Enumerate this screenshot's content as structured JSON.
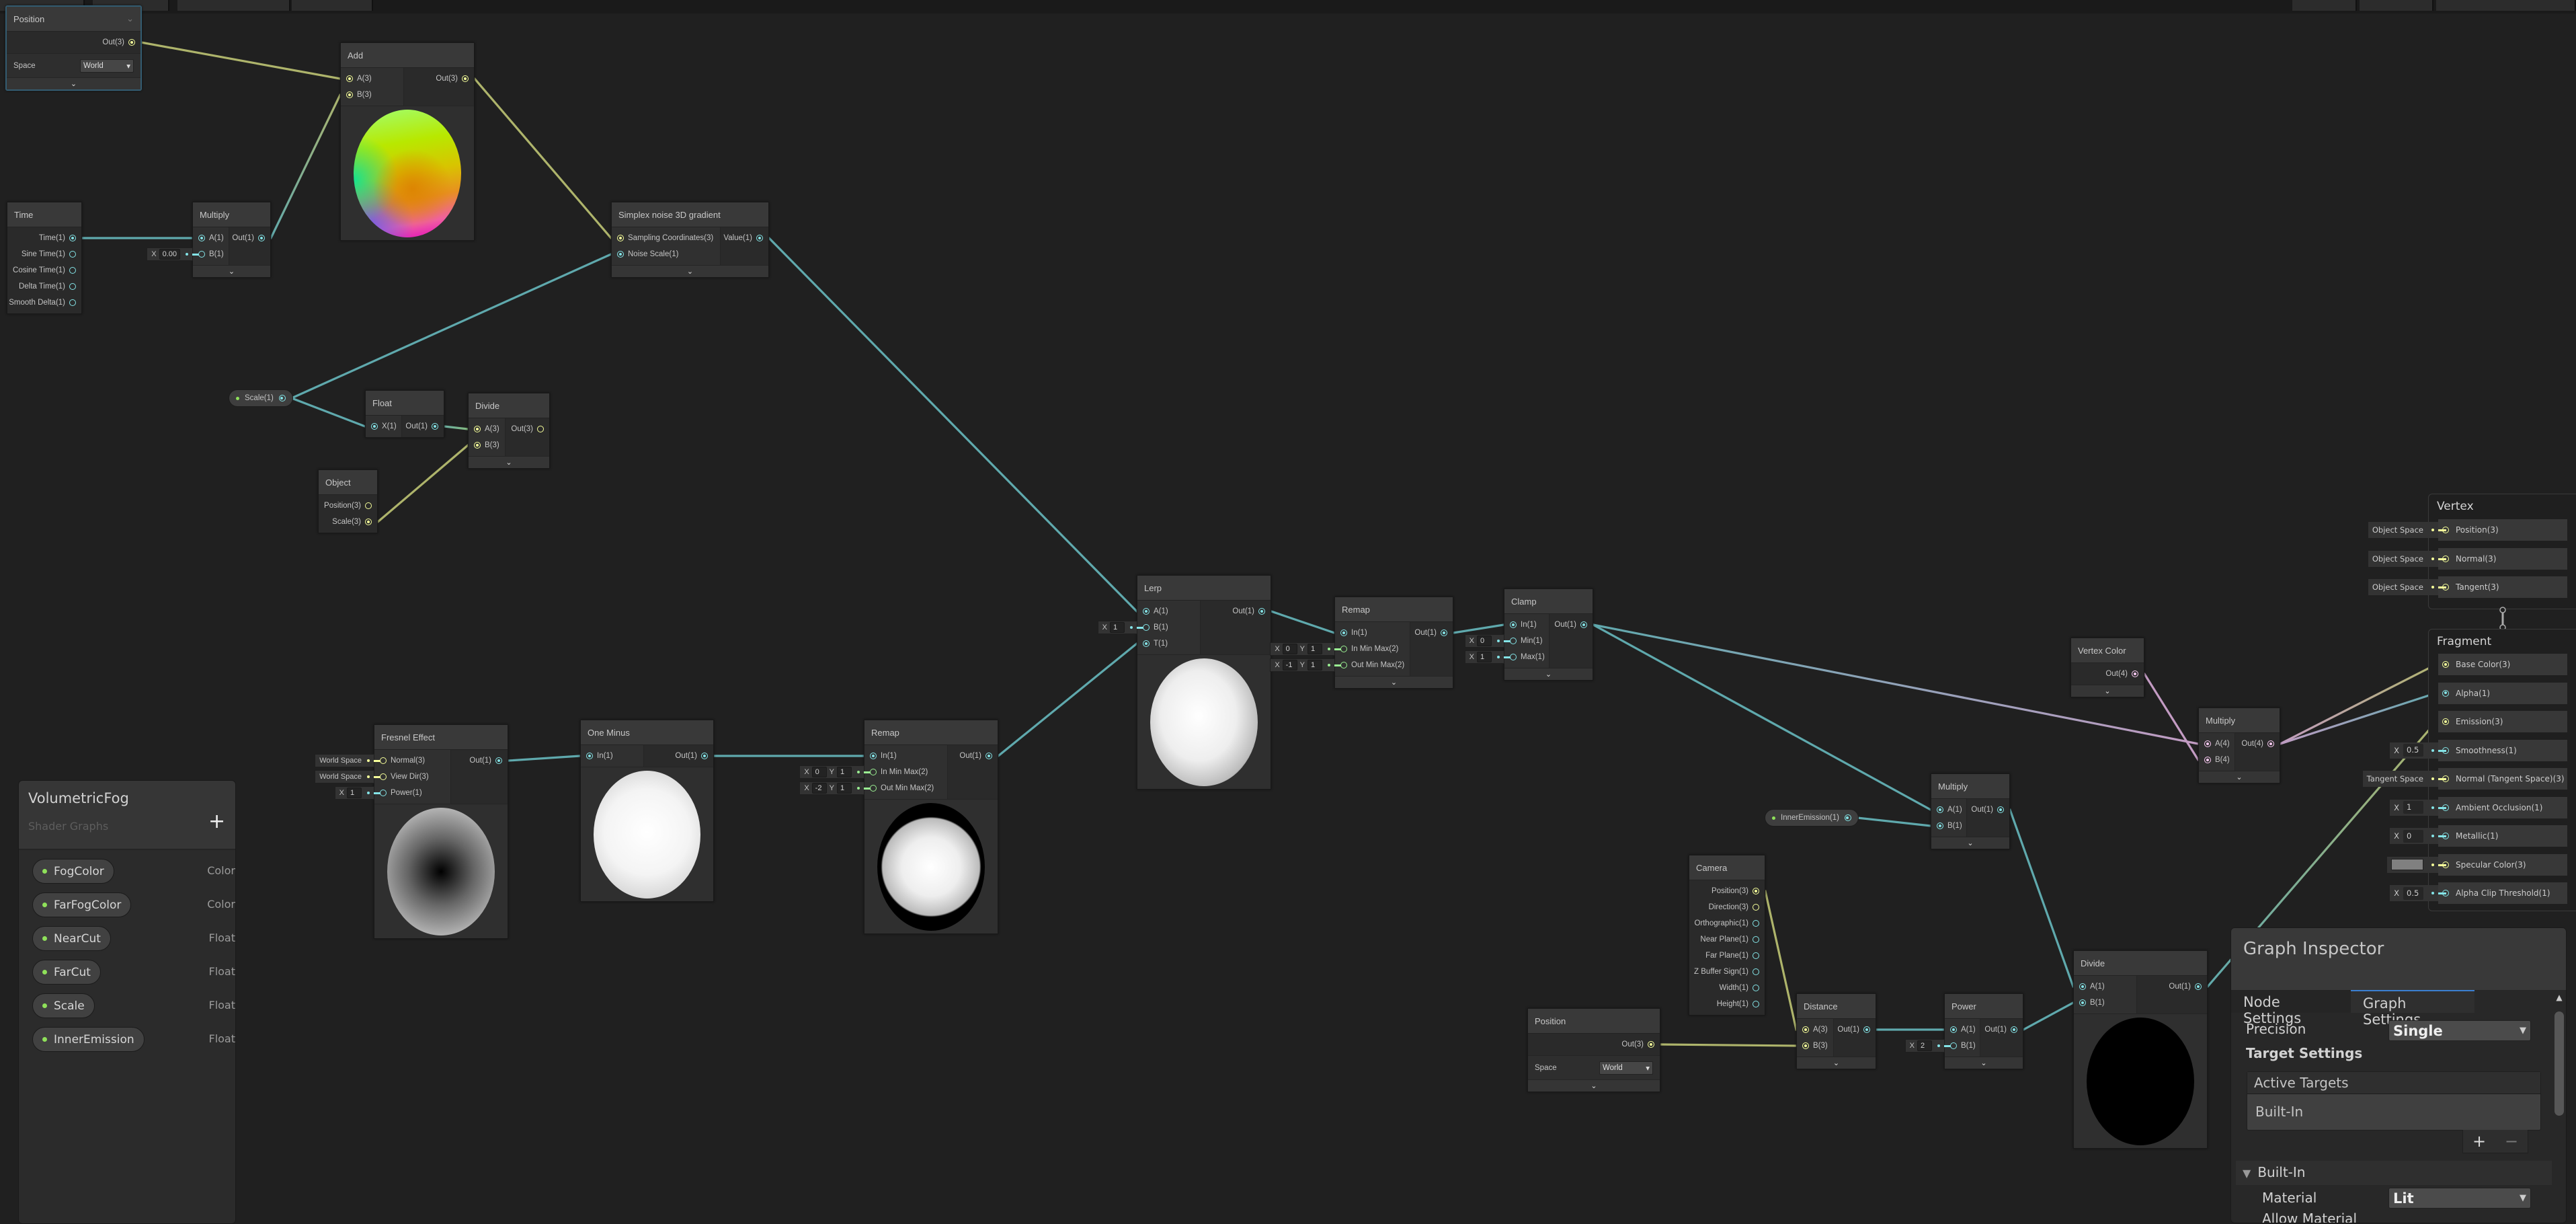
{
  "colors": {
    "port1": "#84e4e7",
    "port2": "#9aef92",
    "port3": "#f6ff9a",
    "port4": "#fbcbf4",
    "edge1": "#5fa9ad",
    "edge2": "#8fbf74",
    "edge3": "#aeb46b",
    "edge4": "#c39bc3",
    "accent": "#3b7fd0",
    "canvas": "#202020"
  },
  "nodes": [
    {
      "title": "Position",
      "collapse_icon": "chevron-down-icon",
      "inputs": [],
      "outputs": [
        "Out(3)"
      ],
      "fields": [
        {
          "label": "Space",
          "value": "World"
        }
      ]
    },
    {
      "title": "Add",
      "inputs": [
        {
          "label": "A(3)"
        },
        {
          "label": "B(3)"
        }
      ],
      "outputs": [
        "Out(3)"
      ],
      "preview": "color-sphere"
    },
    {
      "title": "Time",
      "inputs": [],
      "outputs": [
        "Time(1)",
        "Sine Time(1)",
        "Cosine Time(1)",
        "Delta Time(1)",
        "Smooth Delta(1)"
      ]
    },
    {
      "title": "Multiply",
      "inputs": [
        {
          "label": "A(1)"
        },
        {
          "label": "B(1)",
          "inline": [
            "X",
            "0.00"
          ]
        }
      ],
      "outputs": [
        "Out(1)"
      ]
    },
    {
      "title": "Simplex noise 3D gradient",
      "inputs": [
        {
          "label": "Sampling Coordinates(3)"
        },
        {
          "label": "Noise Scale(1)"
        }
      ],
      "outputs": [
        "Value(1)"
      ]
    },
    {
      "title": "Float",
      "inputs": [
        {
          "label": "X(1)"
        }
      ],
      "outputs": [
        "Out(1)"
      ]
    },
    {
      "title": "Divide",
      "inputs": [
        {
          "label": "A(3)"
        },
        {
          "label": "B(3)"
        }
      ],
      "outputs": [
        "Out(3)"
      ]
    },
    {
      "title": "Object",
      "inputs": [],
      "outputs": [
        "Position(3)",
        "Scale(3)"
      ]
    },
    {
      "title": "Lerp",
      "inputs": [
        {
          "label": "A(1)"
        },
        {
          "label": "B(1)",
          "inline": [
            "X",
            "1"
          ]
        },
        {
          "label": "T(1)"
        }
      ],
      "outputs": [
        "Out(1)"
      ],
      "preview": "lerp-blob"
    },
    {
      "title": "Remap",
      "inputs": [
        {
          "label": "In(1)"
        },
        {
          "label": "In Min Max(2)",
          "inline": [
            "X",
            "0",
            "Y",
            "1"
          ]
        },
        {
          "label": "Out Min Max(2)",
          "inline": [
            "X",
            "-1",
            "Y",
            "1"
          ]
        }
      ],
      "outputs": [
        "Out(1)"
      ]
    },
    {
      "title": "Clamp",
      "inputs": [
        {
          "label": "In(1)"
        },
        {
          "label": "Min(1)",
          "inline": [
            "X",
            "0"
          ]
        },
        {
          "label": "Max(1)",
          "inline": [
            "X",
            "1"
          ]
        }
      ],
      "outputs": [
        "Out(1)"
      ]
    },
    {
      "title": "Fresnel Effect",
      "inputs": [
        {
          "label": "Normal(3)",
          "inline": [
            "World Space"
          ]
        },
        {
          "label": "View Dir(3)",
          "inline": [
            "World Space"
          ]
        },
        {
          "label": "Power(1)",
          "inline": [
            "X",
            "1"
          ]
        }
      ],
      "outputs": [
        "Out(1)"
      ],
      "preview": "fresnel"
    },
    {
      "title": "One Minus",
      "inputs": [
        {
          "label": "In(1)"
        }
      ],
      "outputs": [
        "Out(1)"
      ],
      "preview": "white-sphere"
    },
    {
      "title": "Remap",
      "inputs": [
        {
          "label": "In(1)"
        },
        {
          "label": "In Min Max(2)",
          "inline": [
            "X",
            "0",
            "Y",
            "1"
          ]
        },
        {
          "label": "Out Min Max(2)",
          "inline": [
            "X",
            "-2",
            "Y",
            "1"
          ]
        }
      ],
      "outputs": [
        "Out(1)"
      ],
      "preview": "ring"
    },
    {
      "title": "Vertex Color",
      "inputs": [],
      "outputs": [
        "Out(4)"
      ]
    },
    {
      "title": "Multiply",
      "inputs": [
        {
          "label": "A(4)"
        },
        {
          "label": "B(4)"
        }
      ],
      "outputs": [
        "Out(4)"
      ]
    },
    {
      "title": "Multiply",
      "inputs": [
        {
          "label": "A(1)"
        },
        {
          "label": "B(1)"
        }
      ],
      "outputs": [
        "Out(1)"
      ]
    },
    {
      "title": "Camera",
      "inputs": [],
      "outputs": [
        "Position(3)",
        "Direction(3)",
        "Orthographic(1)",
        "Near Plane(1)",
        "Far Plane(1)",
        "Z Buffer Sign(1)",
        "Width(1)",
        "Height(1)"
      ]
    },
    {
      "title": "Position",
      "inputs": [],
      "outputs": [
        "Out(3)"
      ],
      "fields": [
        {
          "label": "Space",
          "value": "World"
        }
      ]
    },
    {
      "title": "Distance",
      "inputs": [
        {
          "label": "A(3)"
        },
        {
          "label": "B(3)"
        }
      ],
      "outputs": [
        "Out(1)"
      ]
    },
    {
      "title": "Power",
      "inputs": [
        {
          "label": "A(1)"
        },
        {
          "label": "B(1)",
          "inline": [
            "X",
            "2"
          ]
        }
      ],
      "outputs": [
        "Out(1)"
      ]
    },
    {
      "title": "Divide",
      "inputs": [
        {
          "label": "A(1)"
        },
        {
          "label": "B(1)"
        }
      ],
      "outputs": [
        "Out(1)"
      ],
      "preview": "black-sphere"
    }
  ],
  "property_nodes": [
    {
      "label": "Scale(1)"
    },
    {
      "label": "InnerEmission(1)"
    }
  ],
  "master": {
    "vertex": {
      "title": "Vertex",
      "rows": [
        {
          "label": "Position(3)",
          "inline": [
            "Object Space"
          ]
        },
        {
          "label": "Normal(3)",
          "inline": [
            "Object Space"
          ]
        },
        {
          "label": "Tangent(3)",
          "inline": [
            "Object Space"
          ]
        }
      ]
    },
    "fragment": {
      "title": "Fragment",
      "rows": [
        {
          "label": "Base Color(3)"
        },
        {
          "label": "Alpha(1)"
        },
        {
          "label": "Emission(3)"
        },
        {
          "label": "Smoothness(1)",
          "inline": [
            "X",
            "0.5"
          ]
        },
        {
          "label": "Normal (Tangent Space)(3)",
          "inline": [
            "Tangent Space"
          ]
        },
        {
          "label": "Ambient Occlusion(1)",
          "inline": [
            "X",
            "1"
          ]
        },
        {
          "label": "Metallic(1)",
          "inline": [
            "X",
            "0"
          ]
        },
        {
          "label": "Specular Color(3)",
          "swatch": "#808080"
        },
        {
          "label": "Alpha Clip Threshold(1)",
          "inline": [
            "X",
            "0.5"
          ]
        }
      ]
    }
  },
  "blackboard": {
    "title": "VolumetricFog",
    "subtitle": "Shader Graphs",
    "add_icon": "plus-icon",
    "properties": [
      {
        "name": "FogColor",
        "type": "Color"
      },
      {
        "name": "FarFogColor",
        "type": "Color"
      },
      {
        "name": "NearCut",
        "type": "Float"
      },
      {
        "name": "FarCut",
        "type": "Float"
      },
      {
        "name": "Scale",
        "type": "Float"
      },
      {
        "name": "InnerEmission",
        "type": "Float"
      }
    ]
  },
  "inspector": {
    "title": "Graph Inspector",
    "tabs": [
      "Node Settings",
      "Graph Settings"
    ],
    "active_tab": "Graph Settings",
    "precision_label": "Precision",
    "precision_value": "Single",
    "target_settings_label": "Target Settings",
    "active_targets_label": "Active Targets",
    "targets": [
      "Built-In"
    ],
    "add_label": "+",
    "remove_label": "−",
    "builtin_section": "Built-In",
    "material_label": "Material",
    "material_value": "Lit",
    "allow_material_label": "Allow Material"
  }
}
